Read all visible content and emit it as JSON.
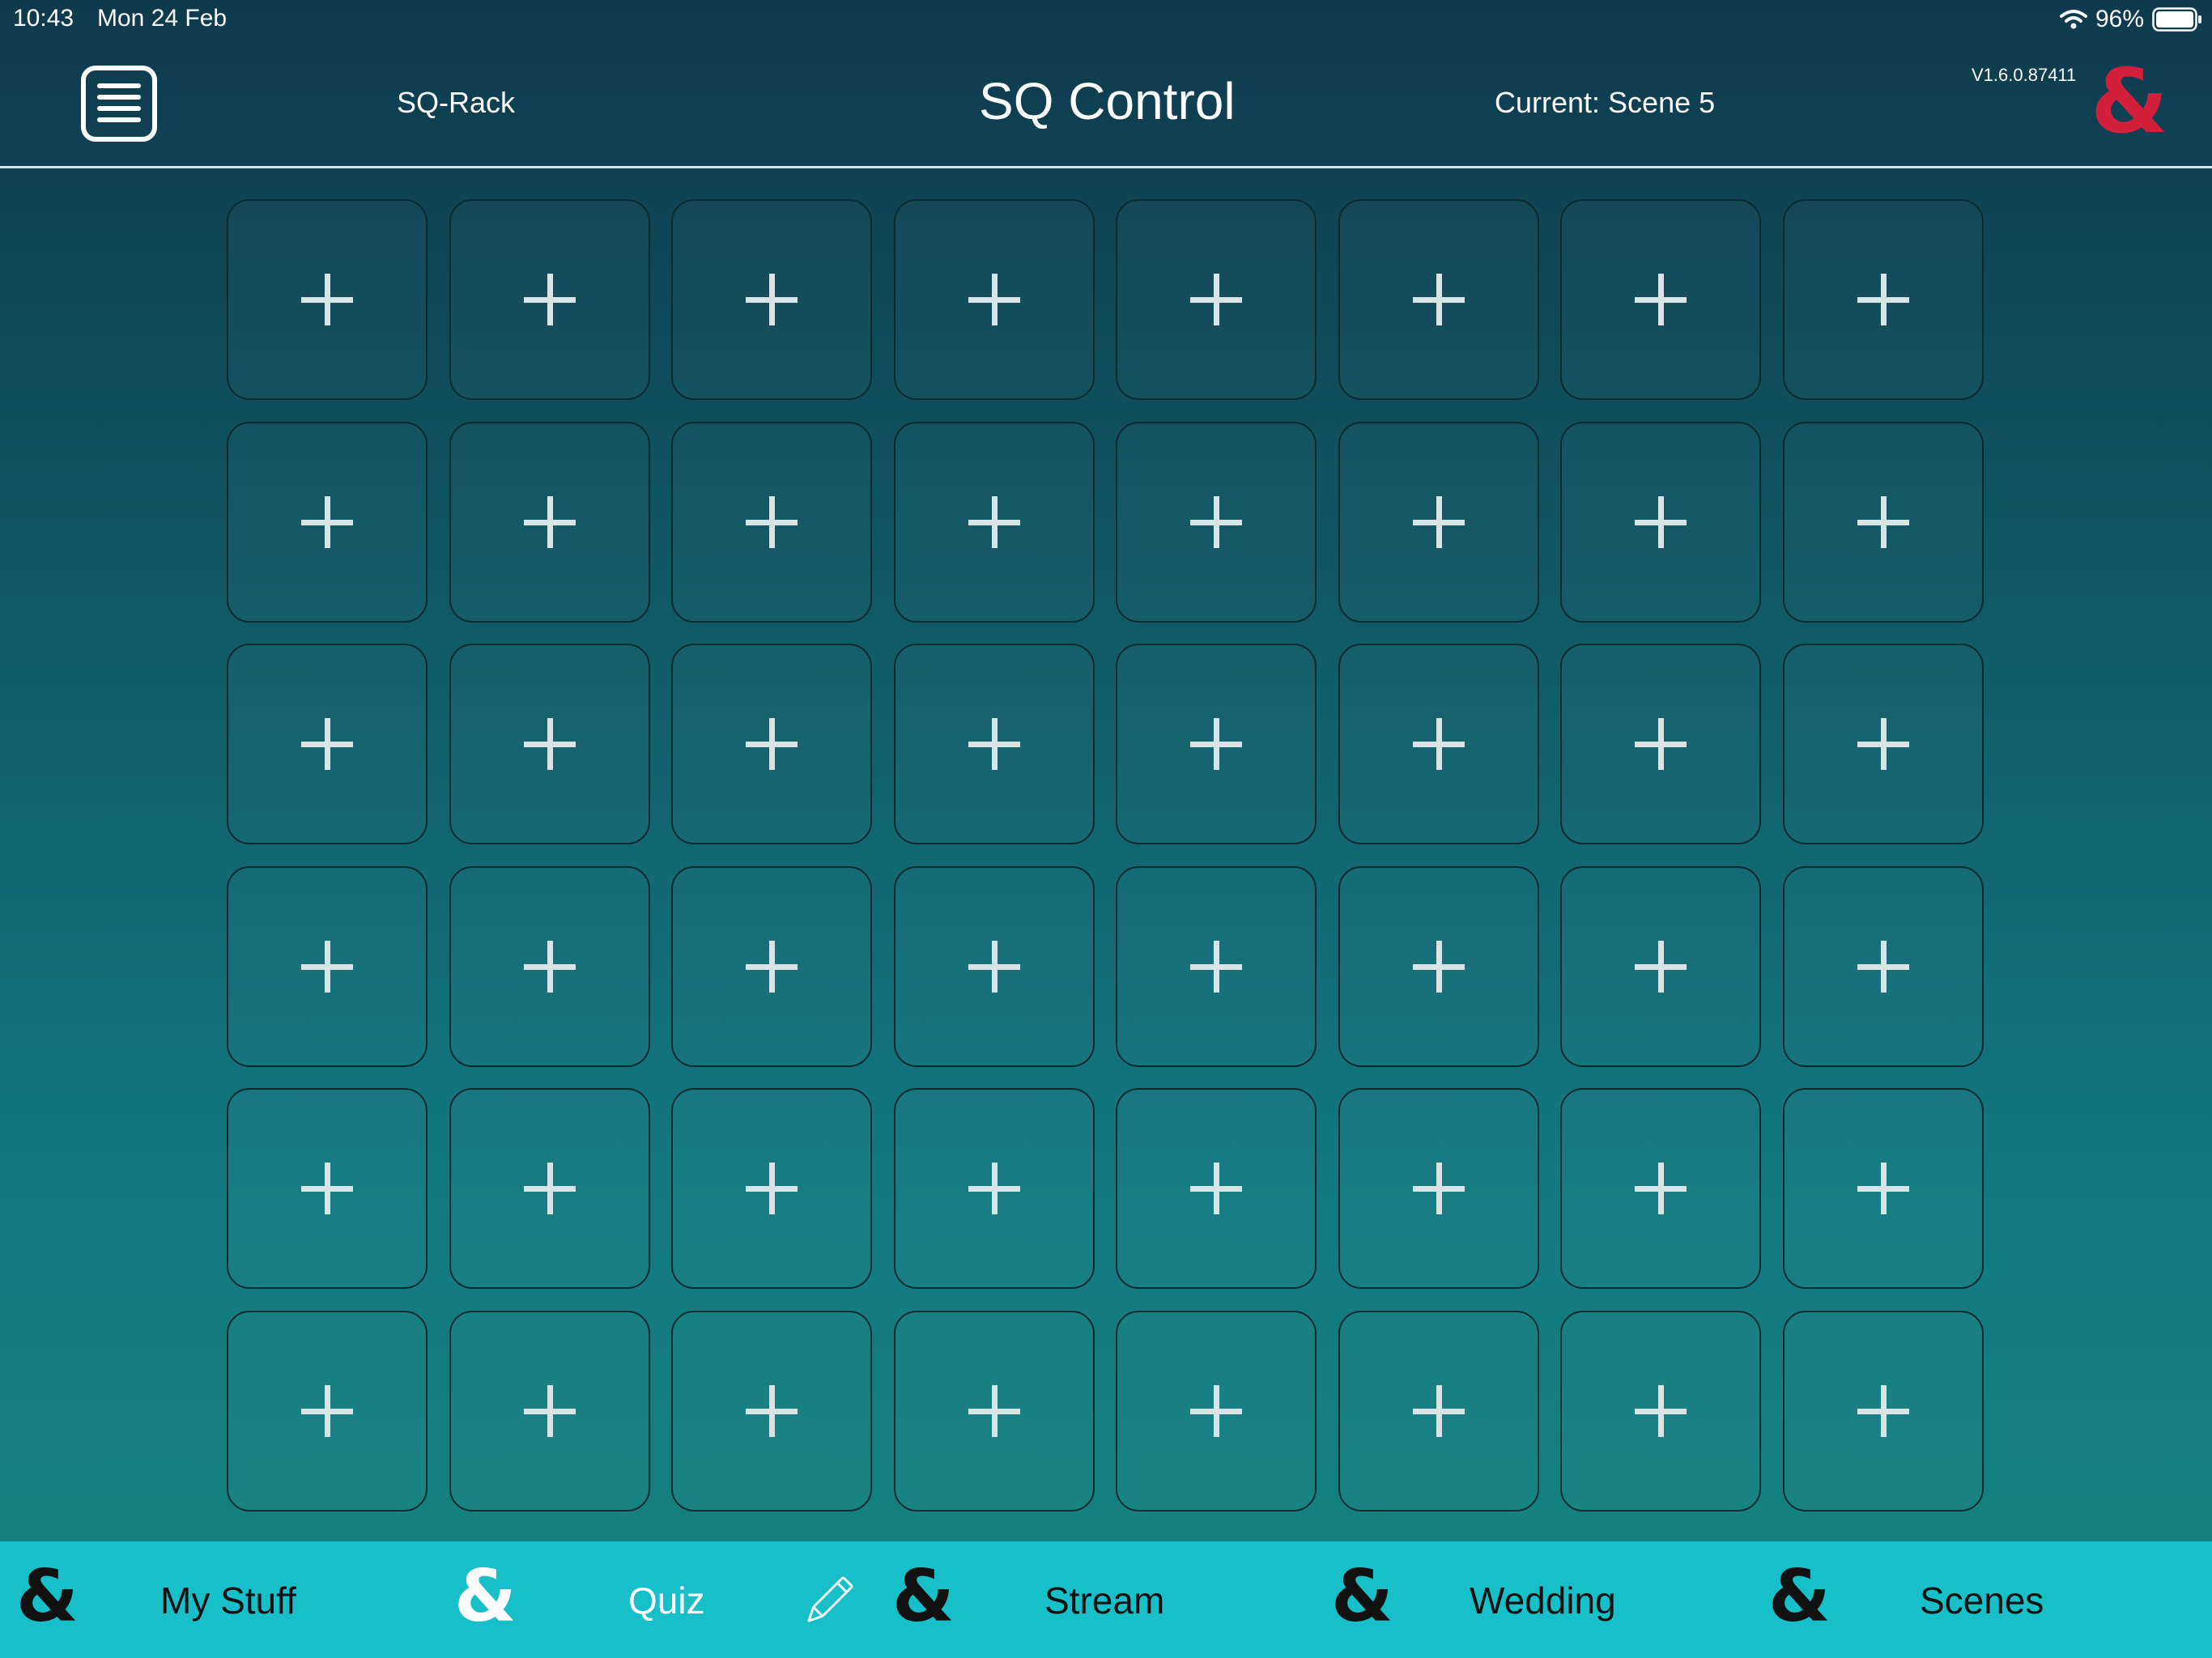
{
  "status_bar": {
    "time": "10:43",
    "date": "Mon 24 Feb",
    "battery": "96%",
    "icons": [
      "wifi-icon",
      "battery-icon"
    ]
  },
  "header": {
    "menu_icon": "hamburger-menu-icon",
    "device_name": "SQ-Rack",
    "title": "SQ Control",
    "current_scene": "Current: Scene 5",
    "version": "V1.6.0.87411",
    "logo": "&"
  },
  "grid": {
    "rows": 6,
    "columns": 8,
    "slot_icon": "plus-icon",
    "slot_symbol": "+"
  },
  "tabs": [
    {
      "logo": "&",
      "label": "My Stuff",
      "active": false
    },
    {
      "logo": "&",
      "label": "Quiz",
      "active": true
    },
    {
      "logo": "&",
      "label": "Stream",
      "active": false
    },
    {
      "logo": "&",
      "label": "Wedding",
      "active": false
    },
    {
      "logo": "&",
      "label": "Scenes",
      "active": false
    }
  ],
  "edit_icon": "pencil-icon",
  "colors": {
    "brand_red": "#d21f3c",
    "tab_bar": "#17c0c9",
    "background_top": "#0f3a4e",
    "background_bottom": "#14807f"
  }
}
